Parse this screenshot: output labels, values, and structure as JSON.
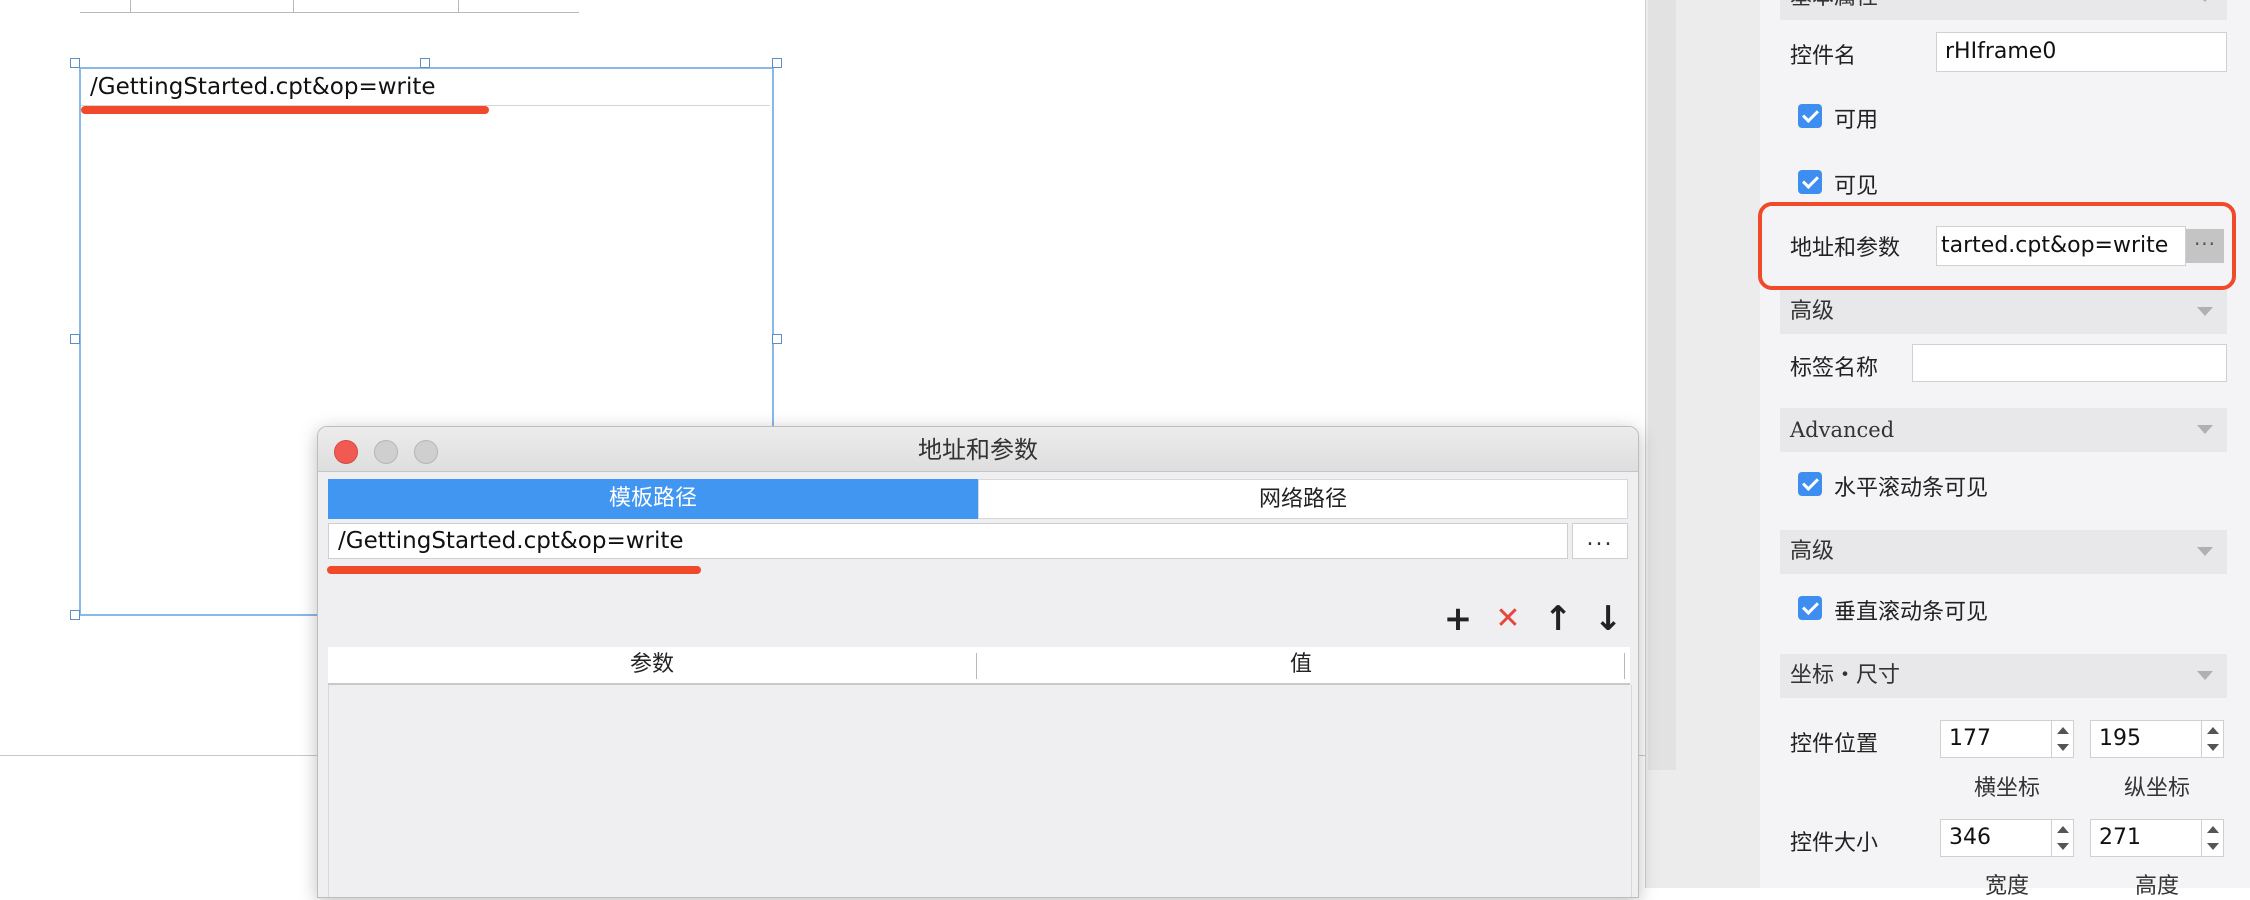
{
  "canvas": {
    "frame_url": "/GettingStarted.cpt&op=write"
  },
  "dialog": {
    "title": "地址和参数",
    "tabs": [
      {
        "label": "模板路径",
        "active": true
      },
      {
        "label": "网络路径",
        "active": false
      }
    ],
    "path_value": "/GettingStarted.cpt&op=write",
    "browse_label": "...",
    "toolbar": {
      "add_icon": "+",
      "delete_icon": "✕",
      "up_icon": "↑",
      "down_icon": "↓"
    },
    "table": {
      "columns": [
        "参数",
        "值"
      ]
    }
  },
  "panel": {
    "section_basic": "基本属性",
    "widget_name_label": "控件名",
    "widget_name_value": "rHIframe0",
    "enabled_label": "可用",
    "visible_label": "可见",
    "address_label": "地址和参数",
    "address_value": "tarted.cpt&op=write",
    "address_button": "···",
    "section_advanced_cn": "高级",
    "tag_name_label": "标签名称",
    "tag_name_value": "",
    "section_advanced_en": "Advanced",
    "hscroll_label": "水平滚动条可见",
    "section_advanced_cn2": "高级",
    "vscroll_label": "垂直滚动条可见",
    "section_coords": "坐标・尺寸",
    "position_label": "控件位置",
    "pos_x": "177",
    "pos_y": "195",
    "x_label": "横坐标",
    "y_label": "纵坐标",
    "size_label": "控件大小",
    "width_value": "346",
    "height_value": "271",
    "width_label": "宽度",
    "height_label": "高度"
  },
  "colors": {
    "accent": "#4096f0",
    "highlight": "#f04a2a",
    "checkbox": "#3d8ef0"
  }
}
